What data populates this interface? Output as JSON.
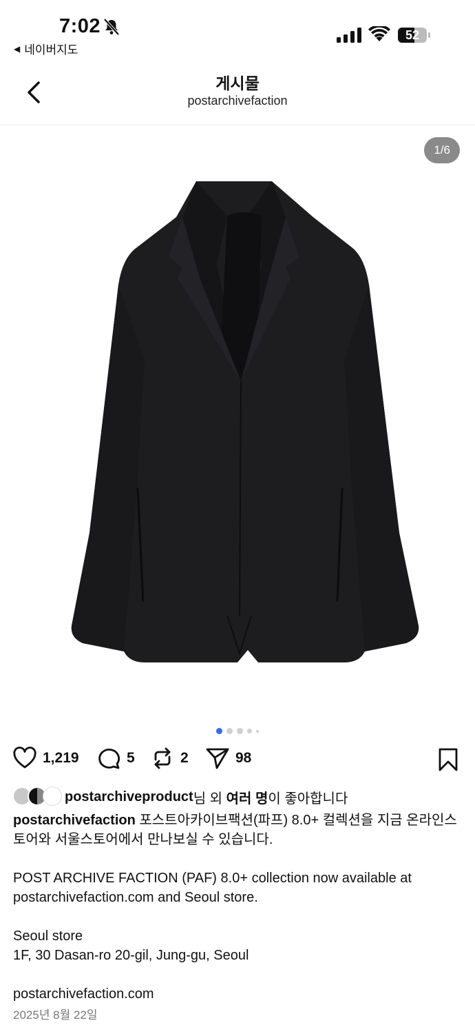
{
  "status_bar": {
    "time": "7:02",
    "back_app": "네이버지도",
    "battery": "52"
  },
  "header": {
    "title": "게시물",
    "subtitle": "postarchivefaction"
  },
  "media": {
    "counter": "1/6",
    "total_dots": 5,
    "active_dot": 0
  },
  "actions": {
    "likes": "1,219",
    "comments": "5",
    "reposts": "2",
    "shares": "98"
  },
  "liked_by": {
    "user": "postarchiveproduct",
    "suffix1": "님 외 ",
    "others": "여러 명",
    "suffix2": "이 좋아합니다"
  },
  "caption": {
    "username": "postarchivefaction",
    "korean_text": " 포스트아카이브팩션(파프) 8.0+ 컬렉션을 지금 온라인스토어와 서울스토어에서 만나보실 수 있습니다.",
    "english_text": "POST ARCHIVE FACTION (PAF) 8.0+ collection now available at postarchivefaction.com and Seoul store.",
    "store_title": "Seoul store",
    "store_address": "1F, 30 Dasan-ro 20-gil, Jung-gu, Seoul",
    "website": "postarchivefaction.com"
  },
  "date": "2025년 8월 22일"
}
